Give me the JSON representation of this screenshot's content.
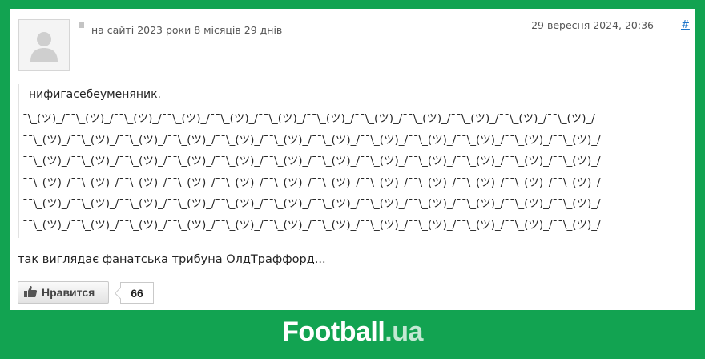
{
  "comment": {
    "on_site": "на сайті 2023 роки 8 місяців 29 днів",
    "date": "29 вересня 2024, 20:36",
    "anchor": "#",
    "quote": {
      "author": "нифигасебеуменяник.",
      "lines": [
        "¯\\_(ツ)_/¯¯\\_(ツ)_/¯¯\\_(ツ)_/¯¯\\_(ツ)_/¯¯\\_(ツ)_/¯¯\\_(ツ)_/¯¯\\_(ツ)_/¯¯\\_(ツ)_/¯¯\\_(ツ)_/¯¯\\_(ツ)_/¯¯\\_(ツ)_/¯¯\\_(ツ)_/",
        "¯¯\\_(ツ)_/¯¯\\_(ツ)_/¯¯\\_(ツ)_/¯¯\\_(ツ)_/¯¯\\_(ツ)_/¯¯\\_(ツ)_/¯¯\\_(ツ)_/¯¯\\_(ツ)_/¯¯\\_(ツ)_/¯¯\\_(ツ)_/¯¯\\_(ツ)_/¯¯\\_(ツ)_/",
        "¯¯\\_(ツ)_/¯¯\\_(ツ)_/¯¯\\_(ツ)_/¯¯\\_(ツ)_/¯¯\\_(ツ)_/¯¯\\_(ツ)_/¯¯\\_(ツ)_/¯¯\\_(ツ)_/¯¯\\_(ツ)_/¯¯\\_(ツ)_/¯¯\\_(ツ)_/¯¯\\_(ツ)_/",
        "¯¯\\_(ツ)_/¯¯\\_(ツ)_/¯¯\\_(ツ)_/¯¯\\_(ツ)_/¯¯\\_(ツ)_/¯¯\\_(ツ)_/¯¯\\_(ツ)_/¯¯\\_(ツ)_/¯¯\\_(ツ)_/¯¯\\_(ツ)_/¯¯\\_(ツ)_/¯¯\\_(ツ)_/",
        "¯¯\\_(ツ)_/¯¯\\_(ツ)_/¯¯\\_(ツ)_/¯¯\\_(ツ)_/¯¯\\_(ツ)_/¯¯\\_(ツ)_/¯¯\\_(ツ)_/¯¯\\_(ツ)_/¯¯\\_(ツ)_/¯¯\\_(ツ)_/¯¯\\_(ツ)_/¯¯\\_(ツ)_/",
        "¯¯\\_(ツ)_/¯¯\\_(ツ)_/¯¯\\_(ツ)_/¯¯\\_(ツ)_/¯¯\\_(ツ)_/¯¯\\_(ツ)_/¯¯\\_(ツ)_/¯¯\\_(ツ)_/¯¯\\_(ツ)_/¯¯\\_(ツ)_/¯¯\\_(ツ)_/¯¯\\_(ツ)_/"
      ]
    },
    "text": "так виглядає фанатська трибуна ОлдТраффорд...",
    "like_label": "Нравится",
    "like_count": "66"
  },
  "footer": {
    "logo_main": "Football",
    "logo_suffix": ".ua"
  },
  "icons": {
    "avatar": "default-avatar-icon",
    "like": "thumbs-up-icon"
  },
  "colors": {
    "background": "#12a351",
    "link": "#1a73c9"
  }
}
